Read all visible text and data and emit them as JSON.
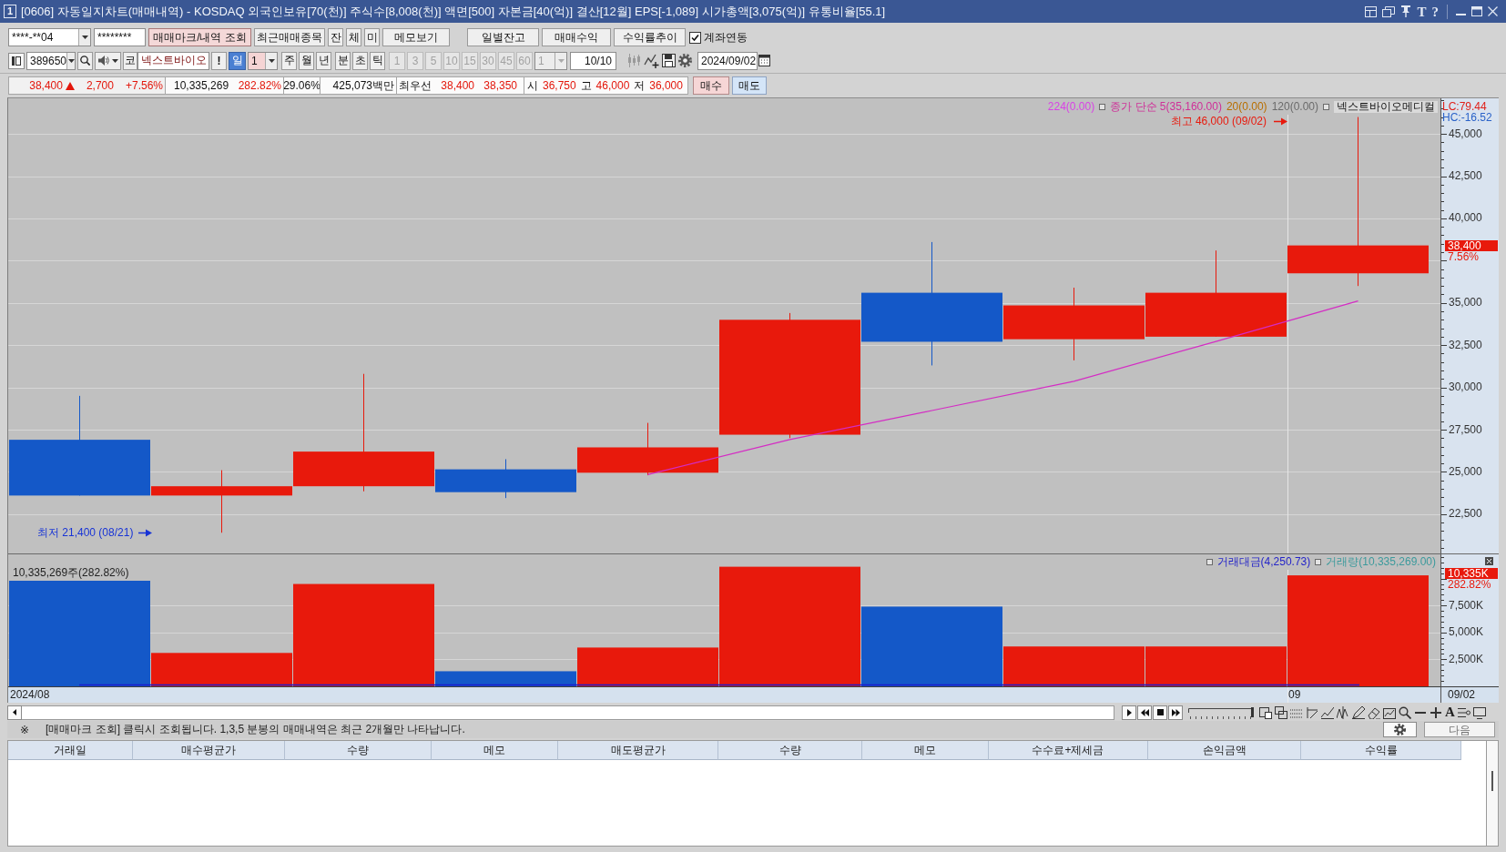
{
  "window": {
    "number": "1",
    "title": "[0606] 자동일지차트(매매내역) - KOSDAQ 외국인보유[70(천)] 주식수[8,008(천)] 액면[500] 자본금[40(억)] 결산[12월] EPS[-1,089] 시가총액[3,075(억)] 유통비율[55.1]",
    "tool_glyphs": [
      "T",
      "?"
    ]
  },
  "toolbar": {
    "account": "****-**04",
    "password": "********",
    "buttons": [
      {
        "label": "매매마크/내역 조회",
        "selected": true
      },
      {
        "label": "최근매매종목",
        "selected": false
      },
      {
        "label": "잔",
        "selected": false
      },
      {
        "label": "체",
        "selected": false
      },
      {
        "label": "미",
        "selected": false
      },
      {
        "label": "메모보기",
        "selected": false
      }
    ],
    "report_buttons": [
      "일별잔고",
      "매매수익",
      "수익률추이"
    ],
    "checkbox": {
      "label": "계좌연동",
      "checked": true
    }
  },
  "symbol_bar": {
    "code": "389650",
    "market_button": "코",
    "name": "넥스트바이오",
    "alert_button": "!",
    "periods": [
      {
        "label": "일",
        "selected": true
      },
      {
        "label": "주",
        "selected": false
      },
      {
        "label": "월",
        "selected": false
      },
      {
        "label": "년",
        "selected": false
      },
      {
        "label": "분",
        "selected": false
      },
      {
        "label": "초",
        "selected": false
      },
      {
        "label": "틱",
        "selected": false
      }
    ],
    "period_count": "1",
    "minute_buttons": [
      {
        "label": "1",
        "disabled": true
      },
      {
        "label": "3",
        "disabled": true
      },
      {
        "label": "5",
        "disabled": true
      },
      {
        "label": "10",
        "disabled": true
      },
      {
        "label": "15",
        "disabled": true
      },
      {
        "label": "30",
        "disabled": true
      },
      {
        "label": "45",
        "disabled": true
      },
      {
        "label": "60",
        "disabled": true
      }
    ],
    "minute_combo": {
      "value": "1",
      "disabled": true
    },
    "display_count": "10/10",
    "date": "2024/09/02"
  },
  "quote": {
    "groups": [
      {
        "cells": [
          {
            "kind": "rise",
            "text": "38,400"
          },
          {
            "kind": "rise-arrow"
          },
          {
            "kind": "rise",
            "text": "2,700"
          },
          {
            "kind": "rise",
            "text": "+7.56%"
          }
        ]
      },
      {
        "cells": [
          {
            "kind": "plain",
            "text": "10,335,269"
          },
          {
            "kind": "rise",
            "text": "282.82%"
          }
        ]
      },
      {
        "cells": [
          {
            "kind": "plain",
            "text": "29.06%"
          }
        ]
      },
      {
        "cells": [
          {
            "kind": "plain",
            "text": "425,073백만"
          }
        ]
      },
      {
        "cells": [
          {
            "kind": "plain",
            "text": "최우선"
          },
          {
            "kind": "rise",
            "text": "38,400"
          },
          {
            "kind": "rise",
            "text": "38,350"
          }
        ]
      },
      {
        "cells": [
          {
            "kind": "plain",
            "text": "시"
          },
          {
            "kind": "rise",
            "text": "36,750"
          },
          {
            "kind": "plain",
            "text": "고"
          },
          {
            "kind": "rise",
            "text": "46,000"
          },
          {
            "kind": "plain",
            "text": "저"
          },
          {
            "kind": "rise",
            "text": "36,000"
          }
        ]
      }
    ],
    "trade_buttons": [
      {
        "label": "매수",
        "kind": "buy"
      },
      {
        "label": "매도",
        "kind": "sell"
      }
    ]
  },
  "chart": {
    "legend": [
      {
        "kind": "text",
        "text": "224(0.00)",
        "color": "#d940e6"
      },
      {
        "kind": "toggle"
      },
      {
        "kind": "text",
        "text": "종가 단순 5(35,160.00)",
        "color": "#cf2f98"
      },
      {
        "kind": "text",
        "text": "20(0.00)",
        "color": "#b86e00"
      },
      {
        "kind": "text",
        "text": "120(0.00)",
        "color": "#6a6a6a"
      },
      {
        "kind": "toggle"
      },
      {
        "kind": "title",
        "text": "넥스트바이오메디컬"
      }
    ],
    "indicators": [
      {
        "text": "LC:79.44",
        "color": "#e0201a"
      },
      {
        "text": "HC:-16.52",
        "color": "#2a62c8"
      }
    ],
    "high_marker": "최고 46,000 (09/02)",
    "low_marker": "최저 21,400 (08/21)",
    "price_labels": [
      "45,000",
      "42,500",
      "40,000",
      "35,000",
      "32,500",
      "30,000",
      "27,500",
      "25,000",
      "22,500"
    ],
    "price_tag": {
      "value": "38,400",
      "change": "7.56%"
    },
    "volume": {
      "caption": "10,335,269주(282.82%)",
      "legend": [
        {
          "kind": "toggle"
        },
        {
          "kind": "text",
          "text": "거래대금(4,250.73)",
          "color": "#2424c8"
        },
        {
          "kind": "toggle"
        },
        {
          "kind": "text",
          "text": "거래량(10,335,269.00)",
          "color": "#3c9a9c"
        }
      ],
      "tag": {
        "value": "10,335K",
        "change": "282.82%"
      },
      "chart_data": {
        "type": "bar",
        "grid": true,
        "ylim": [
          0,
          12250000
        ],
        "yticks": [
          {
            "value": 2500000,
            "label": "2,500K"
          },
          {
            "value": 5000000,
            "label": "5,000K"
          },
          {
            "value": 7500000,
            "label": "7,500K"
          }
        ],
        "series": [
          {
            "color": "#e8190c",
            "values": [
              null,
              3100000,
              9500000,
              null,
              3600000,
              11100000,
              null,
              3700000,
              3700000,
              10300000
            ]
          },
          {
            "color": "#1458c8",
            "values": [
              9800000,
              null,
              null,
              1400000,
              null,
              null,
              7400000,
              null,
              null,
              null
            ]
          }
        ]
      }
    },
    "x_labels": [
      "2024/08",
      "09"
    ],
    "current_date": "09/02"
  },
  "nav": {
    "zoom_slider": {
      "level": 1
    },
    "glyph": "A"
  },
  "notice": {
    "mark": "※",
    "text": "[매매마크 조회] 클릭시 조회됩니다. 1,3,5 분봉의 매매내역은 최근 2개월만 나타납니다.",
    "next_button": "다음"
  },
  "table": {
    "columns": [
      "거래일",
      "매수평균가",
      "수량",
      "메모",
      "매도평균가",
      "수량",
      "메모",
      "수수료+제세금",
      "손익금액",
      "수익률"
    ]
  }
}
